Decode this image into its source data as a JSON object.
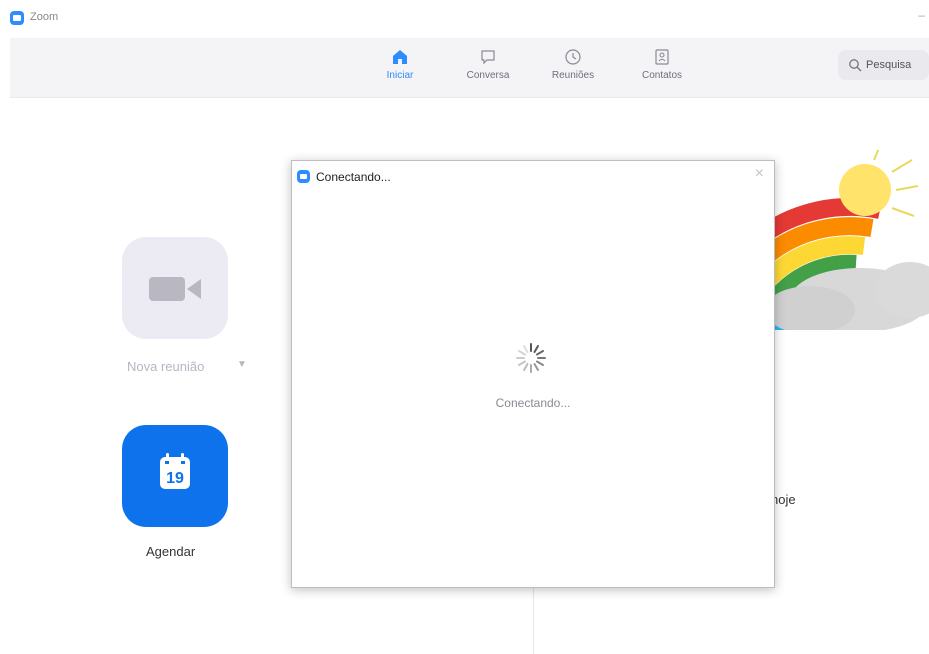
{
  "app": {
    "title": "Zoom"
  },
  "nav": {
    "tabs": [
      {
        "label": "Iniciar",
        "icon": "home-icon",
        "active": true
      },
      {
        "label": "Conversa",
        "icon": "chat-icon",
        "active": false
      },
      {
        "label": "Reuniões",
        "icon": "clock-icon",
        "active": false
      },
      {
        "label": "Contatos",
        "icon": "contacts-icon",
        "active": false
      }
    ],
    "search_label": "Pesquisa"
  },
  "home": {
    "new_meeting_label": "Nova reunião",
    "schedule_label": "Agendar",
    "calendar_day": "19",
    "today_text": "hoje"
  },
  "dialog": {
    "title": "Conectando...",
    "status": "Conectando..."
  },
  "colors": {
    "accent": "#2d8cff",
    "schedule_tile": "#0e72ed",
    "new_meeting_tile": "#eceaf2"
  }
}
